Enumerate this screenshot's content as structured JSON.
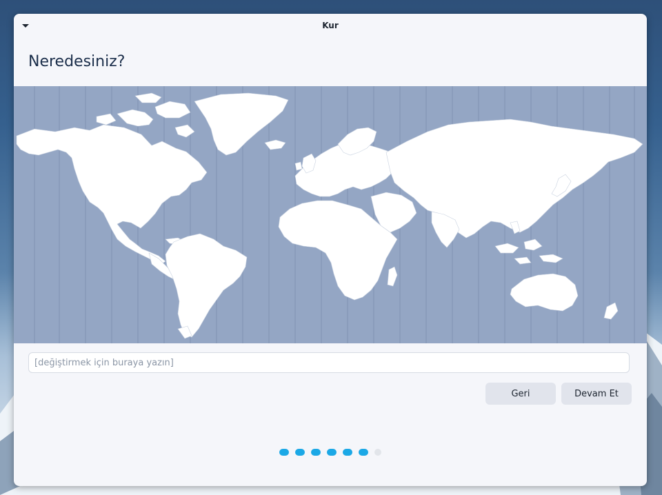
{
  "window": {
    "title": "Kur"
  },
  "page": {
    "title": "Neredesiniz?"
  },
  "timezone_input": {
    "value": "",
    "placeholder": "[değiştirmek için buraya yazın]"
  },
  "buttons": {
    "back_label": "Geri",
    "next_label": "Devam Et"
  },
  "progress": {
    "total_steps": 7,
    "completed_steps": 6
  },
  "colors": {
    "accent": "#1ba8e6",
    "map_ocean": "#94a6c4",
    "map_land": "#ffffff",
    "window_bg": "#f5f6fa"
  },
  "icons": {
    "menu": "triangle-down-icon"
  }
}
